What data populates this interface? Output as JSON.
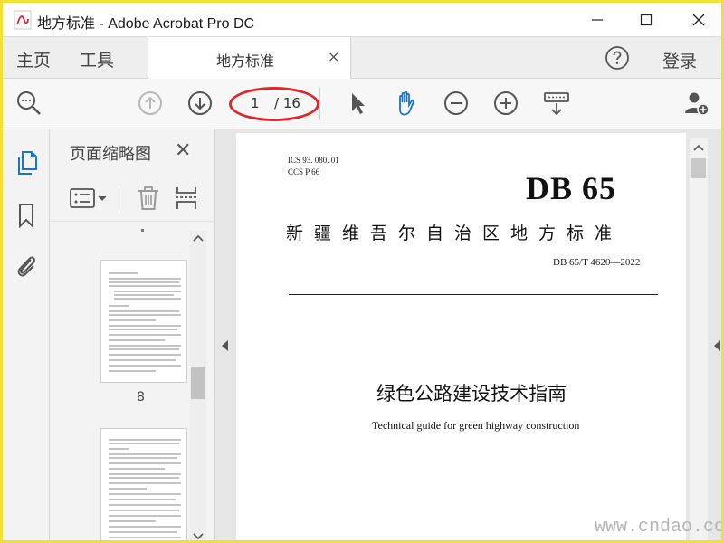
{
  "window": {
    "title": "地方标准 - Adobe Acrobat Pro DC",
    "logo_text": "地方标准"
  },
  "menu": {
    "home": "主页",
    "tools": "工具",
    "login": "登录"
  },
  "tab": {
    "label": "地方标准",
    "close": "×"
  },
  "toolbar": {
    "page_current": "1",
    "page_total": "/ 16"
  },
  "thumbnails": {
    "title": "页面缩略图",
    "close": "✕",
    "pages": [
      {
        "number": "8"
      }
    ]
  },
  "document": {
    "ics": "ICS  93. 080. 01",
    "ccs": "CCS  P  66",
    "code": "DB 65",
    "region": "新疆维吾尔自治区地方标准",
    "standard_no": "DB 65/T  4620—2022",
    "title_cn": "绿色公路建设技术指南",
    "title_en": "Technical guide for green highway construction"
  },
  "watermark": "www.cndao.com",
  "colors": {
    "accent_blue": "#1e74c8",
    "annotation_red": "#e0262a",
    "frame_yellow": "#f1df3a"
  }
}
